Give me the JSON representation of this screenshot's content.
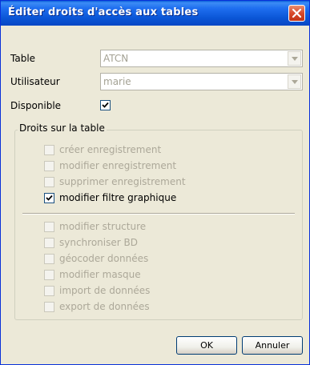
{
  "window": {
    "title": "Éditer droits d'accès aux tables",
    "close_icon": "close-icon"
  },
  "form": {
    "table_label": "Table",
    "table_value": "ATCN",
    "user_label": "Utilisateur",
    "user_value": "marie",
    "available_label": "Disponible",
    "available_checked": true
  },
  "group": {
    "title": "Droits sur la table",
    "rights_1": [
      {
        "label": "créer enregistrement",
        "checked": false,
        "enabled": false
      },
      {
        "label": "modifier enregistrement",
        "checked": false,
        "enabled": false
      },
      {
        "label": "supprimer enregistrement",
        "checked": false,
        "enabled": false
      },
      {
        "label": "modifier filtre graphique",
        "checked": true,
        "enabled": true
      }
    ],
    "rights_2": [
      {
        "label": "modifier structure",
        "checked": false,
        "enabled": false
      },
      {
        "label": "synchroniser BD",
        "checked": false,
        "enabled": false
      },
      {
        "label": "géocoder données",
        "checked": false,
        "enabled": false
      },
      {
        "label": "modifier masque",
        "checked": false,
        "enabled": false
      },
      {
        "label": "import de données",
        "checked": false,
        "enabled": false
      },
      {
        "label": "export de données",
        "checked": false,
        "enabled": false
      }
    ]
  },
  "buttons": {
    "ok": "OK",
    "cancel": "Annuler"
  }
}
